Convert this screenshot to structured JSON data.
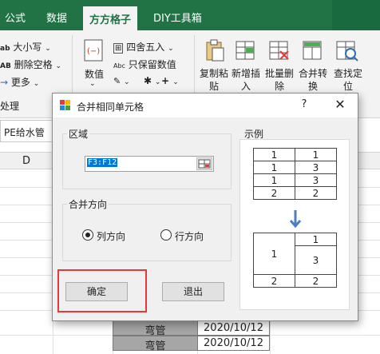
{
  "ribbon_tabs": [
    "公式",
    "数据",
    "方方格子",
    "DIY工具箱"
  ],
  "ribbon": {
    "case_label": "大小写",
    "remove_space_label": "删除空格",
    "more_label": "更多",
    "group_label": "处理",
    "numeric_label": "数值",
    "round_label": "四舍五入",
    "keep_numeric_label": "只保留数值",
    "plus_label": "+",
    "copy_paste": [
      "复制粘",
      "贴"
    ],
    "new_insert": [
      "新增插",
      "入"
    ],
    "batch_delete": [
      "批量删",
      "除"
    ],
    "merge_convert": [
      "合并转",
      "换"
    ],
    "find_locate": [
      "查找定",
      "位"
    ]
  },
  "name_box": "PE给水管",
  "column_header": "D",
  "sheet_rows": [
    {
      "name": "弯管",
      "date": "2020/10/12"
    },
    {
      "name": "弯管",
      "date": "2020/10/12"
    }
  ],
  "dialog": {
    "title": "合并相同单元格",
    "help": "?",
    "close": "✕",
    "range_group": "区域",
    "range_value": "F3:F12",
    "direction_group": "合并方向",
    "option_column": "列方向",
    "option_row": "行方向",
    "selected_option": "列方向",
    "ok": "确定",
    "exit": "退出",
    "example_label": "示例",
    "example_before": [
      [
        "1",
        "1"
      ],
      [
        "1",
        "3"
      ],
      [
        "1",
        "3"
      ],
      [
        "2",
        "2"
      ]
    ],
    "example_after": {
      "merged_left": "1",
      "right_top": "1",
      "right_merged": "3",
      "bottom": [
        "2",
        "2"
      ]
    }
  },
  "colors": {
    "excel_green": "#217346",
    "highlight_red": "#e53935",
    "arrow_blue": "#4a7fc1"
  }
}
